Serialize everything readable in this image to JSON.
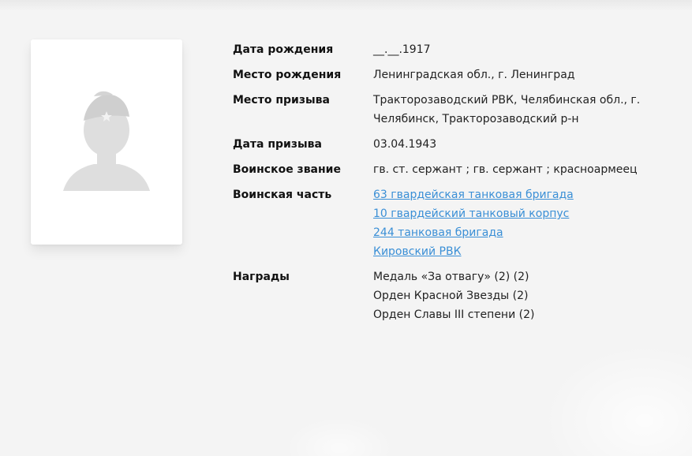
{
  "profile": {
    "photo_placeholder": "silhouette-soldier-icon",
    "fields": {
      "birth_date": {
        "label": "Дата рождения",
        "value": "__.__.1917"
      },
      "birth_place": {
        "label": "Место рождения",
        "value": "Ленинградская обл., г. Ленинград"
      },
      "draft_place": {
        "label": "Место призыва",
        "lines": [
          "Тракторозаводский РВК, Челябинская обл., г.",
          "Челябинск, Тракторозаводский р-н"
        ]
      },
      "draft_date": {
        "label": "Дата призыва",
        "value": "03.04.1943"
      },
      "rank": {
        "label": "Воинское звание",
        "value": "гв. ст. сержант ; гв. сержант ; красноармеец"
      },
      "unit": {
        "label": "Воинская часть",
        "links": [
          "63 гвардейская танковая бригада",
          "10 гвардейский танковый корпус",
          "244 танковая бригада",
          "Кировский РВК"
        ]
      },
      "awards": {
        "label": "Награды",
        "items": [
          "Медаль «За отвагу» (2) (2)",
          "Орден Красной Звезды (2)",
          "Орден Славы III степени (2)"
        ]
      }
    }
  },
  "colors": {
    "background": "#f4f4f4",
    "link": "#3a8fd6",
    "silhouette": "#dedede"
  }
}
